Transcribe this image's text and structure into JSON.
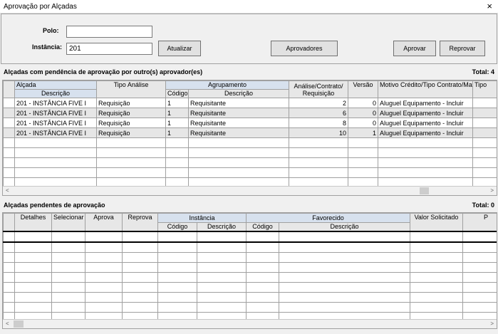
{
  "window": {
    "title": "Aprovação por Alçadas",
    "close_icon": "×"
  },
  "form": {
    "polo_label": "Polo:",
    "polo_value": "",
    "instancia_label": "Instância:",
    "instancia_value": "201"
  },
  "buttons": {
    "atualizar": "Atualizar",
    "aprovadores": "Aprovadores",
    "aprovar": "Aprovar",
    "reprovar": "Reprovar"
  },
  "grid1": {
    "title": "Alçadas com pendência de aprovação por outro(s) aprovador(es)",
    "total": "Total: 4",
    "headers": {
      "alcada": "Alçada",
      "descricao": "Descrição",
      "tipo_analise": "Tipo Análise",
      "agrupamento": "Agrupamento",
      "codigo": "Código",
      "descricao2": "Descrição",
      "analise": "Análise/Contrato/ Requisição",
      "versao": "Versão",
      "motivo": "Motivo Crédito/Tipo Contrato/Mater",
      "tipo_trunc": "Tipo"
    },
    "rows": [
      {
        "alcada": "201 - INSTÂNCIA FIVE I",
        "tipo": "Requisição",
        "codigo": "1",
        "descricao": "Requisitante",
        "analise": "2",
        "versao": "0",
        "motivo": "Aluguel Equipamento - Incluir"
      },
      {
        "alcada": "201 - INSTÂNCIA FIVE I",
        "tipo": "Requisição",
        "codigo": "1",
        "descricao": "Requisitante",
        "analise": "6",
        "versao": "0",
        "motivo": "Aluguel Equipamento - Incluir"
      },
      {
        "alcada": "201 - INSTÂNCIA FIVE I",
        "tipo": "Requisição",
        "codigo": "1",
        "descricao": "Requisitante",
        "analise": "8",
        "versao": "0",
        "motivo": "Aluguel Equipamento - Incluir"
      },
      {
        "alcada": "201 - INSTÂNCIA FIVE I",
        "tipo": "Requisição",
        "codigo": "1",
        "descricao": "Requisitante",
        "analise": "10",
        "versao": "1",
        "motivo": "Aluguel Equipamento - Incluir"
      }
    ]
  },
  "grid2": {
    "title": "Alçadas pendentes de aprovação",
    "total": "Total: 0",
    "headers": {
      "detalhes": "Detalhes",
      "selecionar": "Selecionar",
      "aprova": "Aprova",
      "reprova": "Reprova",
      "instancia": "Instância",
      "codigo": "Código",
      "descricao": "Descrição",
      "favorecido": "Favorecido",
      "codigo2": "Código",
      "descricao2": "Descrição",
      "valor": "Valor Solicitado",
      "p_trunc": "P"
    }
  },
  "scroll": {
    "left": "<",
    "right": ">"
  }
}
